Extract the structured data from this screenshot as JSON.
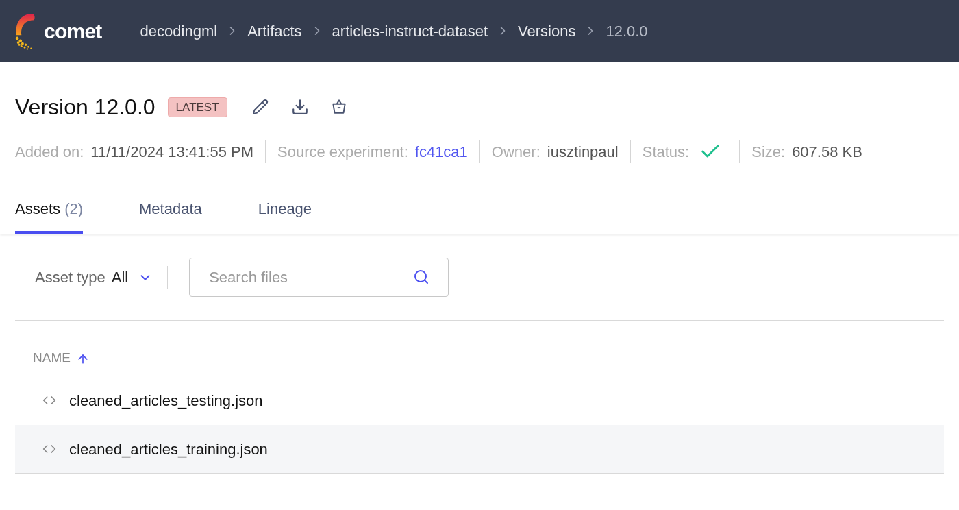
{
  "header": {
    "logo_text": "comet",
    "breadcrumbs": [
      {
        "label": "decodingml",
        "current": false
      },
      {
        "label": "Artifacts",
        "current": false
      },
      {
        "label": "articles-instruct-dataset",
        "current": false
      },
      {
        "label": "Versions",
        "current": false
      },
      {
        "label": "12.0.0",
        "current": true
      }
    ]
  },
  "version": {
    "title": "Version 12.0.0",
    "badge": "LATEST"
  },
  "meta": [
    {
      "kind": "text",
      "label": "Added on:",
      "value": "11/11/2024 13:41:55 PM"
    },
    {
      "kind": "link",
      "label": "Source experiment:",
      "value": "fc41ca1"
    },
    {
      "kind": "text",
      "label": "Owner:",
      "value": "iusztinpaul"
    },
    {
      "kind": "status",
      "label": "Status:",
      "ok": true
    },
    {
      "kind": "text",
      "label": "Size:",
      "value": "607.58 KB"
    }
  ],
  "tabs": [
    {
      "label": "Assets",
      "count": "(2)",
      "selected": true
    },
    {
      "label": "Metadata",
      "selected": false
    },
    {
      "label": "Lineage",
      "selected": false
    }
  ],
  "filter": {
    "label": "Asset type",
    "value": "All"
  },
  "search": {
    "placeholder": "Search files"
  },
  "table": {
    "column": "NAME",
    "rows": [
      {
        "name": "cleaned_articles_testing.json",
        "highlighted": false
      },
      {
        "name": "cleaned_articles_training.json",
        "highlighted": true
      }
    ]
  }
}
